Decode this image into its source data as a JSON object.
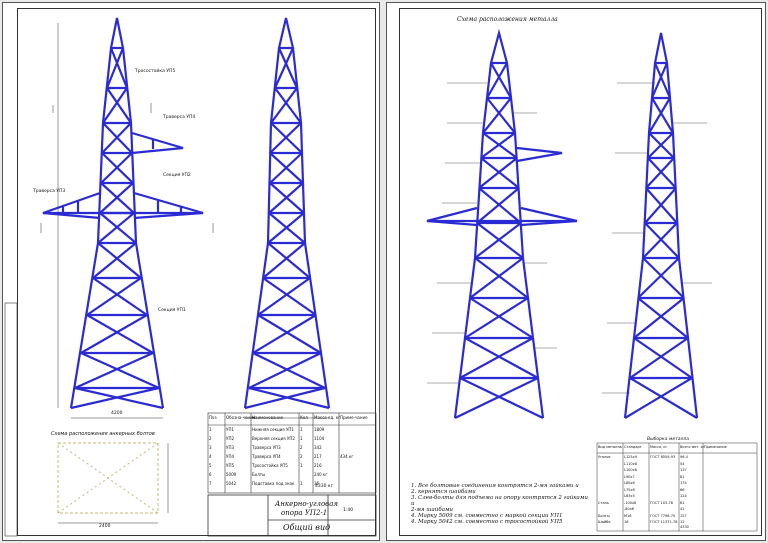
{
  "left_sheet": {
    "bolt_scheme_title": "Схема расположения анкерных болтов",
    "spec_headers": [
      "Поз",
      "Обозна-чение",
      "Наименование",
      "Кол",
      "Масса ед. кг",
      "Приме-чание"
    ],
    "spec_rows": [
      [
        "1",
        "УП1",
        "Нижняя секция УП1",
        "1",
        "1809",
        ""
      ],
      [
        "2",
        "УП2",
        "Верхняя секция УП2",
        "1",
        "1104",
        ""
      ],
      [
        "3",
        "УП3",
        "Траверса УП3",
        "2",
        "342",
        ""
      ],
      [
        "4",
        "УП4",
        "Траверса УП4",
        "2",
        "217",
        "434 кг"
      ],
      [
        "5",
        "УП5",
        "Тросостойка УП5",
        "1",
        "216",
        ""
      ],
      [
        "6",
        "5009",
        "Болты",
        "",
        "240 кг",
        ""
      ],
      [
        "7",
        "5042",
        "Подставка под знак",
        "1",
        "36",
        ""
      ]
    ],
    "total": "4330 кг",
    "title_block": {
      "name_line1": "Анкерно-угловая",
      "name_line2": "опора УП2-1",
      "subtitle": "Общий вид",
      "scale": "1:40"
    },
    "labels": {
      "trosostoika": "Тросостойка УП5",
      "traversa_up3": "Траверса УП3",
      "traversa_up4": "Траверса УП4",
      "sekcia_up2": "Секция УП2",
      "sekcia_up1": "Секция УП1",
      "width": "4200",
      "bolt_dim": "2400"
    }
  },
  "right_sheet": {
    "title": "Схема расположения металла",
    "selection_table_title": "Выборка металла",
    "notes": [
      "1. Все болтовые соединения контрятся 2-мя гайками и",
      "2. кернятся шайбами",
      "3. Слев-болты для подъема на опору контрятся 2 гайками и",
      "   2-мя шайбами",
      "4. Марку 5009 см. совместно с маркой секции УП1",
      "4. Марку 5042 см. совместно с тросостойкой УП5"
    ],
    "table_headers": [
      "Вид металла",
      "Стандарт",
      "Масса, кг",
      "Всего мет. кг",
      "Примечание"
    ],
    "table_rows": [
      [
        "Уголок",
        "L125x9",
        "ГОСТ 8509-93",
        "96.4",
        ""
      ],
      [
        "",
        "L110x8",
        "",
        "54",
        ""
      ],
      [
        "",
        "L100x8",
        "",
        "137",
        ""
      ],
      [
        "",
        "L90x7",
        "",
        "81",
        ""
      ],
      [
        "",
        "L80x6",
        "",
        "174",
        ""
      ],
      [
        "",
        "L75x6",
        "",
        "66",
        ""
      ],
      [
        "",
        "L63x5",
        "",
        "124",
        ""
      ],
      [
        "Сталь",
        "-100x8",
        "ГОСТ 103-76",
        "61",
        ""
      ],
      [
        "",
        "-80x6",
        "",
        "41",
        ""
      ],
      [
        "Болты",
        "М16",
        "ГОСТ 7798-70",
        "157",
        ""
      ],
      [
        "Шайба",
        "16",
        "ГОСТ 11371-78",
        "12",
        ""
      ]
    ],
    "table_total": "4330"
  },
  "colors": {
    "steel": "#2b2bd4",
    "line": "#222222",
    "bolt_scheme": "#c8b67a"
  }
}
